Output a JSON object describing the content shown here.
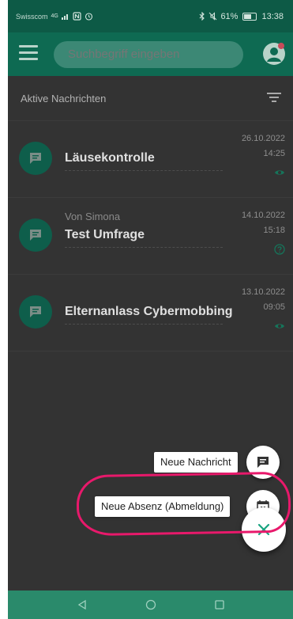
{
  "statusbar": {
    "carrier": "Swisscom",
    "network": "4G",
    "battery": "61%",
    "time": "13:38"
  },
  "appbar": {
    "search_placeholder": "Suchbegriff eingeben"
  },
  "section": {
    "title": "Aktive Nachrichten"
  },
  "messages": [
    {
      "sender": "",
      "title": "Läusekontrolle",
      "date": "26.10.2022",
      "time": "14:25",
      "status_icon": "eye-icon"
    },
    {
      "sender": "Von Simona",
      "title": "Test Umfrage",
      "date": "14.10.2022",
      "time": "15:18",
      "status_icon": "question-icon"
    },
    {
      "sender": "",
      "title": "Elternanlass Cybermobbing",
      "date": "13.10.2022",
      "time": "09:05",
      "status_icon": "eye-icon"
    }
  ],
  "fab": {
    "new_message_label": "Neue Nachricht",
    "new_absence_label": "Neue Absenz (Abmeldung)"
  },
  "colors": {
    "primary": "#0e6a52",
    "accent": "#18a37f",
    "highlight": "#e8196b"
  }
}
